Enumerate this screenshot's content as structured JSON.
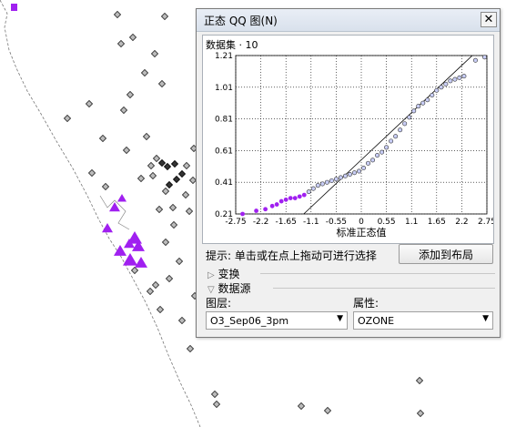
{
  "window": {
    "title": "正态 QQ 图(N)",
    "close_glyph": "✕"
  },
  "plot": {
    "dataset_label": "数据集 · 10",
    "xlabel": "标准正态值",
    "x_ticks": [
      "-2.75",
      "-2.2",
      "-1.65",
      "-1.1",
      "-0.55",
      "0",
      "0.55",
      "1.1",
      "1.65",
      "2.2",
      "2.75"
    ],
    "y_ticks": [
      "0.21",
      "0.41",
      "0.61",
      "0.81",
      "1.01",
      "1.21"
    ],
    "xlim": [
      -2.75,
      2.75
    ],
    "ylim": [
      0.21,
      1.21
    ],
    "line": {
      "x": [
        -1.26,
        2.43
      ],
      "y": [
        0.21,
        1.21
      ]
    },
    "selected_color": "#a020f0",
    "point_color": "#c8cdf5"
  },
  "chart_data": {
    "type": "scatter",
    "xlabel": "标准正态值",
    "ylabel": "",
    "xlim": [
      -2.75,
      2.75
    ],
    "ylim": [
      0.21,
      1.21
    ],
    "grid": true,
    "selected_series": {
      "x": [
        -2.6,
        -2.3,
        -2.1,
        -1.95,
        -1.85,
        -1.75,
        -1.65,
        -1.55,
        -1.45,
        -1.35,
        -1.25
      ],
      "y": [
        0.21,
        0.23,
        0.24,
        0.26,
        0.27,
        0.29,
        0.3,
        0.31,
        0.31,
        0.32,
        0.33
      ]
    },
    "series": {
      "x": [
        -1.15,
        -1.05,
        -0.95,
        -0.85,
        -0.75,
        -0.65,
        -0.55,
        -0.45,
        -0.35,
        -0.25,
        -0.15,
        -0.05,
        0.05,
        0.15,
        0.25,
        0.35,
        0.45,
        0.55,
        0.65,
        0.75,
        0.85,
        0.95,
        1.05,
        1.15,
        1.25,
        1.35,
        1.45,
        1.55,
        1.65,
        1.75,
        1.85,
        1.95,
        2.05,
        2.15,
        2.25,
        2.5,
        2.7
      ],
      "y": [
        0.35,
        0.37,
        0.39,
        0.4,
        0.41,
        0.42,
        0.43,
        0.44,
        0.45,
        0.46,
        0.47,
        0.48,
        0.5,
        0.53,
        0.55,
        0.58,
        0.6,
        0.63,
        0.67,
        0.7,
        0.74,
        0.78,
        0.82,
        0.86,
        0.89,
        0.91,
        0.93,
        0.96,
        0.99,
        1.01,
        1.03,
        1.05,
        1.06,
        1.07,
        1.08,
        1.18,
        1.2
      ]
    }
  },
  "hint": "提示:  单击或在点上拖动可进行选择",
  "add_to_layout": "添加到布局",
  "sections": {
    "transform": "变换",
    "datasource": "数据源",
    "expand_glyph": "▷",
    "collapse_glyph": "▽"
  },
  "fields": {
    "layer_label": "图层:",
    "layer_value": "O3_Sep06_3pm",
    "attr_label": "属性:",
    "attr_value": "OZONE",
    "dropdown_glyph": "▼"
  },
  "map": {
    "marker_color": "#a020f0"
  }
}
